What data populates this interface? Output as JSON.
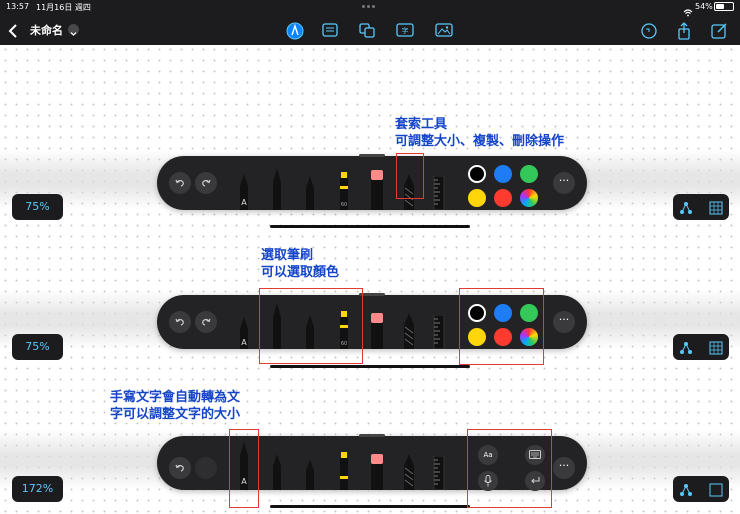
{
  "status_bar": {
    "time": "13:57",
    "date": "11月16日 週四",
    "battery": "54%"
  },
  "header": {
    "title": "未命名"
  },
  "zoom_levels": [
    "75%",
    "75%",
    "172%"
  ],
  "annotations": {
    "lasso": [
      "套索工具",
      "可調整大小、複製、刪除操作"
    ],
    "brush": [
      "選取筆刷",
      "可以選取顏色"
    ],
    "handwriting": [
      "手寫文字會自動轉為文",
      "字可以調整文字的大小"
    ]
  },
  "palette": {
    "swatches": [
      "#000000",
      "#1e7cf5",
      "#34c759",
      "#ffd60a",
      "#ff3b30",
      "rainbow"
    ],
    "handwriting_buttons": {
      "aa_label": "Aa"
    },
    "pen_label": "A",
    "marker_label": "60"
  },
  "colors": {
    "accent": "#5ac8fa",
    "annotation": "#1545c9",
    "highlight_box": "#e53935"
  }
}
